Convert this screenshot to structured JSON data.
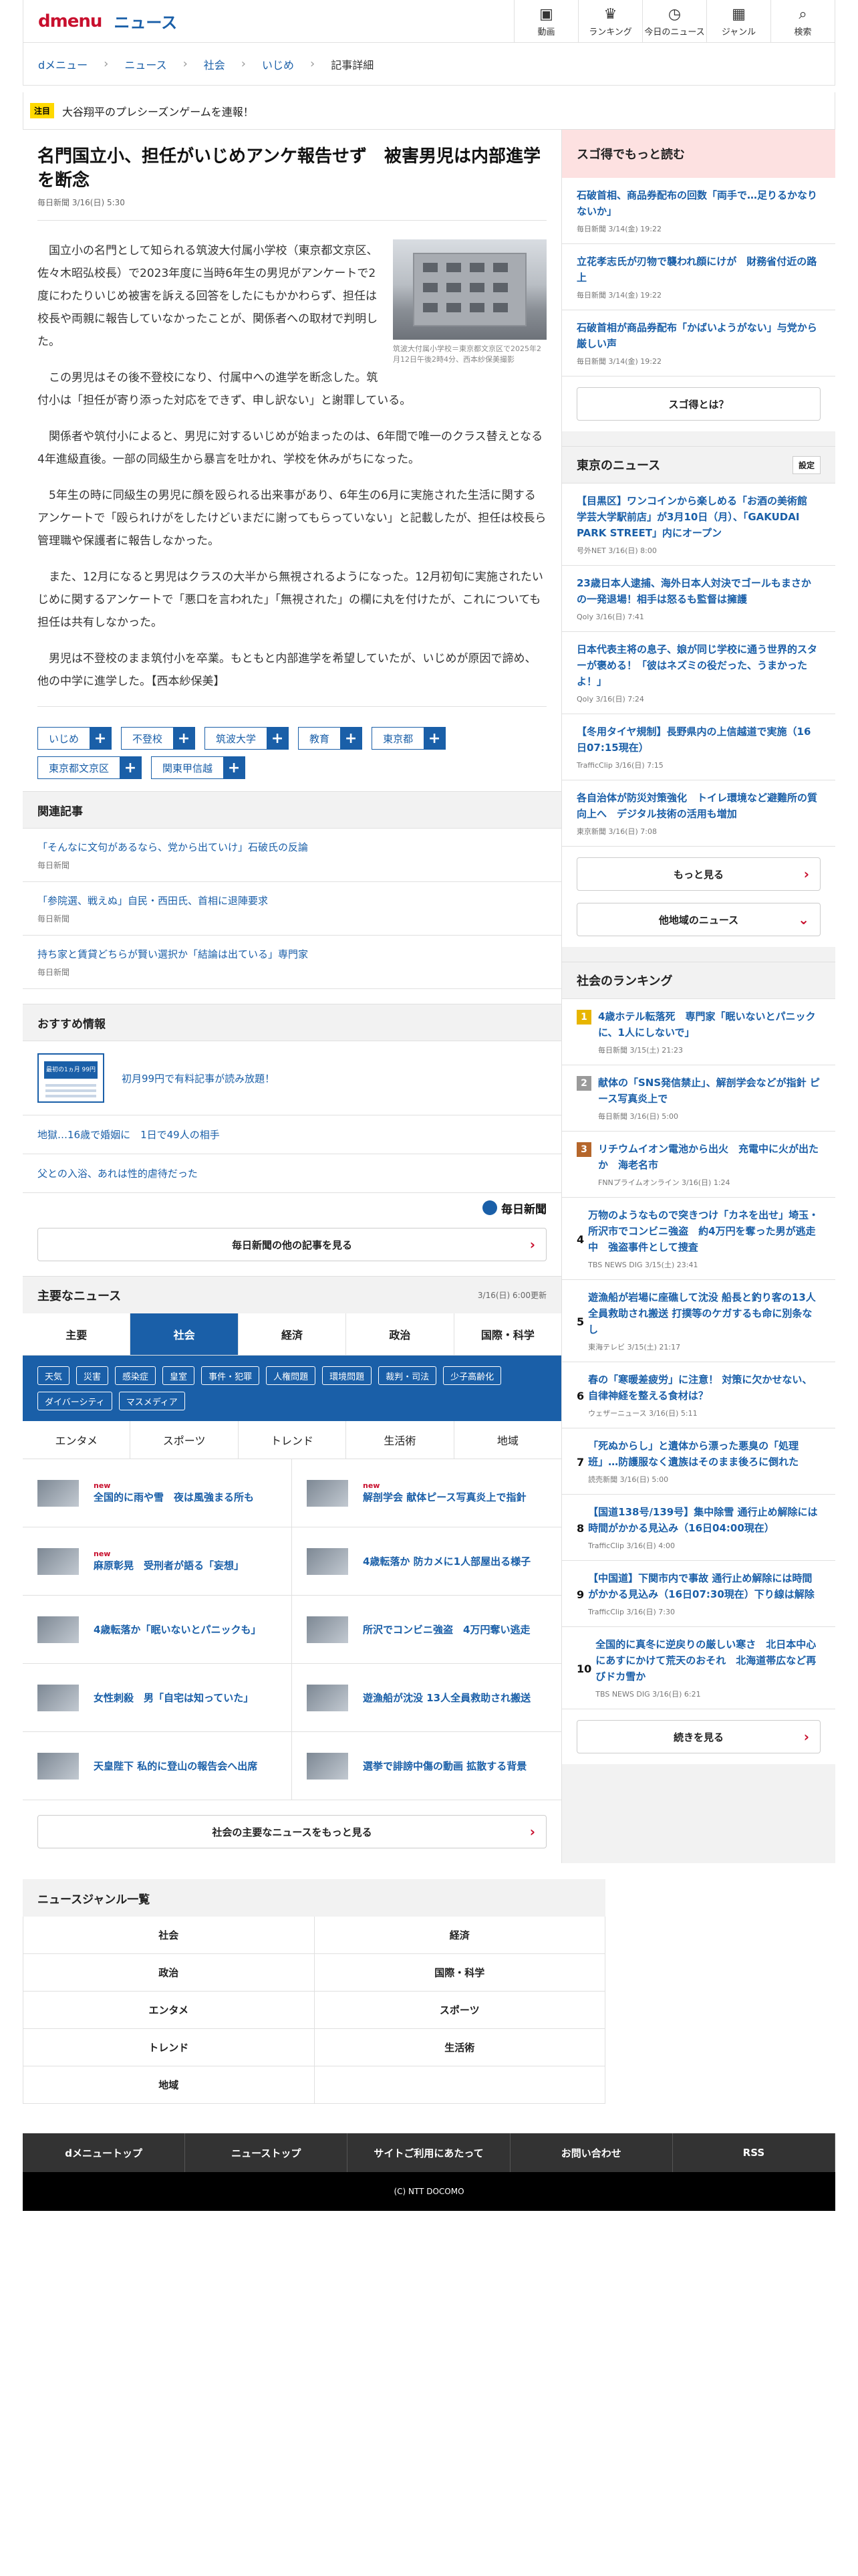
{
  "header": {
    "logo": "dmenu",
    "section": "ニュース",
    "nav": [
      {
        "label": "動画",
        "icon": "video-icon",
        "glyph": "▣"
      },
      {
        "label": "ランキング",
        "icon": "crown-icon",
        "glyph": "♛"
      },
      {
        "label": "今日のニュース",
        "icon": "clock-icon",
        "glyph": "◷"
      },
      {
        "label": "ジャンル",
        "icon": "grid-icon",
        "glyph": "▦"
      },
      {
        "label": "検索",
        "icon": "search-icon",
        "glyph": "⌕"
      }
    ]
  },
  "breadcrumb": [
    "dメニュー",
    "ニュース",
    "社会",
    "いじめ",
    "記事詳細"
  ],
  "notice": {
    "tag": "注目",
    "text": "大谷翔平のプレシーズンゲームを連報！"
  },
  "article": {
    "title": "名門国立小、担任がいじめアンケ報告せず　被害男児は内部進学を断念",
    "meta": "毎日新聞 3/16(日) 5:30",
    "photo_caption": "筑波大付属小学校＝東京都文京区で2025年2月12日午後2時4分、西本紗保美撮影",
    "paragraphs": [
      "国立小の名門として知られる筑波大付属小学校（東京都文京区、佐々木昭弘校長）で2023年度に当時6年生の男児がアンケートで2度にわたりいじめ被害を訴える回答をしたにもかかわらず、担任は校長や両親に報告していなかったことが、関係者への取材で判明した。",
      "この男児はその後不登校になり、付属中への進学を断念した。筑付小は「担任が寄り添った対応をできず、申し訳ない」と謝罪している。",
      "関係者や筑付小によると、男児に対するいじめが始まったのは、6年間で唯一のクラス替えとなる4年進級直後。一部の同級生から暴言を吐かれ、学校を休みがちになった。",
      "5年生の時に同級生の男児に顔を殴られる出来事があり、6年生の6月に実施された生活に関するアンケートで「殴られけがをしたけどいまだに謝ってもらっていない」と記載したが、担任は校長ら管理職や保護者に報告しなかった。",
      "また、12月になると男児はクラスの大半から無視されるようになった。12月初旬に実施されたいじめに関するアンケートで「悪口を言われた」「無視された」の欄に丸を付けたが、これについても担任は共有しなかった。",
      "男児は不登校のまま筑付小を卒業。もともと内部進学を希望していたが、いじめが原因で諦め、他の中学に進学した。【西本紗保美】"
    ],
    "tags": [
      "いじめ",
      "不登校",
      "筑波大学",
      "教育",
      "東京都",
      "東京都文京区",
      "関東甲信越"
    ]
  },
  "related": {
    "heading": "関連記事",
    "items": [
      {
        "title": "「そんなに文句があるなら、党から出ていけ」石破氏の反論",
        "source": "毎日新聞"
      },
      {
        "title": "「参院選、戦えぬ」自民・西田氏、首相に退陣要求",
        "source": "毎日新聞"
      },
      {
        "title": "持ち家と賃貸どちらが賢い選択か「結論は出ている」専門家",
        "source": "毎日新聞"
      }
    ]
  },
  "recommend": {
    "heading": "おすすめ情報",
    "items": [
      "初月99円で有料記事が読み放題！",
      "地獄…16歳で婚姻に　1日で49人の相手",
      "父との入浴、あれは性的虐待だった"
    ],
    "thumb_text": "最初の1ヵ月 99円",
    "brand": "毎日新聞",
    "more": "毎日新聞の他の記事を見る"
  },
  "main_news": {
    "heading": "主要なニュース",
    "updated": "3/16(日) 6:00更新",
    "tabs": [
      "主要",
      "社会",
      "経済",
      "政治",
      "国際・科学"
    ],
    "active_tab": 1,
    "subtags": [
      "天気",
      "災害",
      "感染症",
      "皇室",
      "事件・犯罪",
      "人権問題",
      "環境問題",
      "裁判・司法",
      "少子高齢化",
      "ダイバーシティ",
      "マスメディア"
    ],
    "tabs2": [
      "エンタメ",
      "スポーツ",
      "トレンド",
      "生活術",
      "地域"
    ],
    "items": [
      {
        "title": "全国的に雨や雪　夜は風強まる所も",
        "new": "new"
      },
      {
        "title": "解剖学会 献体ピース写真炎上で指針",
        "new": "new"
      },
      {
        "title": "麻原彰晃　受刑者が語る「妄想」",
        "new": "new"
      },
      {
        "title": "4歳転落か 防カメに1人部屋出る様子",
        "new": ""
      },
      {
        "title": "4歳転落か「眠いないとパニックも」",
        "new": ""
      },
      {
        "title": "所沢でコンビニ強盗　4万円奪い逃走",
        "new": ""
      },
      {
        "title": "女性刺殺　男「自宅は知っていた」",
        "new": ""
      },
      {
        "title": "遊漁船が沈没 13人全員救助され搬送",
        "new": ""
      },
      {
        "title": "天皇陛下 私的に登山の報告会へ出席",
        "new": ""
      },
      {
        "title": "選挙で誹謗中傷の動画 拡散する背景",
        "new": ""
      }
    ],
    "more": "社会の主要なニュースをもっと見る"
  },
  "sugotoku": {
    "heading": "スゴ得でもっと読む",
    "items": [
      {
        "title": "石破首相、商品券配布の回数「両手で…足りるかなりないか」",
        "meta": "毎日新聞 3/14(金) 19:22"
      },
      {
        "title": "立花孝志氏が刃物で襲われ顔にけが　財務省付近の路上",
        "meta": "毎日新聞 3/14(金) 19:22"
      },
      {
        "title": "石破首相が商品券配布「かばいようがない」与党から厳しい声",
        "meta": "毎日新聞 3/14(金) 19:22"
      }
    ],
    "button": "スゴ得とは？"
  },
  "tokyo": {
    "heading": "東京のニュース",
    "settings": "設定",
    "items": [
      {
        "title": "【目黒区】ワンコインから楽しめる「お酒の美術館 学芸大学駅前店」が3月10日（月）、「GAKUDAI PARK STREET」内にオープン",
        "meta": "号外NET 3/16(日) 8:00"
      },
      {
        "title": "23歳日本人逮捕、海外日本人対決でゴールもまさかの一発退場！相手は怒るも監督は擁護",
        "meta": "Qoly 3/16(日) 7:41"
      },
      {
        "title": "日本代表主将の息子、娘が同じ学校に通う世界的スターが褒める！「彼はネズミの役だった、うまかったよ！」",
        "meta": "Qoly 3/16(日) 7:24"
      },
      {
        "title": "【冬用タイヤ規制】長野県内の上信越道で実施（16日07:15現在）",
        "meta": "TrafficClip 3/16(日) 7:15"
      },
      {
        "title": "各自治体が防災対策強化　トイレ環境など避難所の質向上へ　デジタル技術の活用も増加",
        "meta": "東京新聞 3/16(日) 7:08"
      }
    ],
    "more": "もっと見る",
    "other": "他地域のニュース"
  },
  "ranking": {
    "heading": "社会のランキング",
    "items": [
      {
        "title": "4歳ホテル転落死　専門家「眠いないとパニックに、1人にしないで」",
        "meta": "毎日新聞 3/15(土) 21:23"
      },
      {
        "title": "献体の「SNS発信禁止」、解剖学会などが指針 ピース写真炎上で",
        "meta": "毎日新聞 3/16(日) 5:00"
      },
      {
        "title": "リチウムイオン電池から出火　充電中に火が出たか　海老名市",
        "meta": "FNNプライムオンライン 3/16(日) 1:24"
      },
      {
        "title": "万物のようなもので突きつけ「カネを出せ」埼玉・所沢市でコンビニ強盗　約4万円を奪った男が逃走中　強盗事件として捜査",
        "meta": "TBS NEWS DIG 3/15(土) 23:41"
      },
      {
        "title": "遊漁船が岩場に座礁して沈没 船長と釣り客の13人全員救助され搬送 打撲等のケガするも命に別条なし",
        "meta": "東海テレビ 3/15(土) 21:17"
      },
      {
        "title": "春の「寒暖差疲労」に注意！ 対策に欠かせない、自律神経を整える食材は？",
        "meta": "ウェザーニュース 3/16(日) 5:11"
      },
      {
        "title": "「死ぬからし」と遺体から漂った悪臭の「処理班」…防護服なく遺族はそのまま後ろに倒れた",
        "meta": "読売新聞 3/16(日) 5:00"
      },
      {
        "title": "【国道138号/139号】集中除雪 通行止め解除には時間がかかる見込み（16日04:00現在）",
        "meta": "TrafficClip 3/16(日) 4:00"
      },
      {
        "title": "【中国道】下関市内で事故 通行止め解除には時間がかかる見込み（16日07:30現在）下り線は解除",
        "meta": "TrafficClip 3/16(日) 7:30"
      },
      {
        "title": "全国的に真冬に逆戻りの厳しい寒さ　北日本中心にあすにかけて荒天のおそれ　北海道帯広など再びドカ雪か",
        "meta": "TBS NEWS DIG 3/16(日) 6:21"
      }
    ],
    "more": "続きを見る"
  },
  "genre": {
    "heading": "ニュースジャンル一覧",
    "items": [
      "社会",
      "経済",
      "政治",
      "国際・科学",
      "エンタメ",
      "スポーツ",
      "トレンド",
      "生活術",
      "地域",
      ""
    ]
  },
  "footer": {
    "links": [
      "dメニュートップ",
      "ニューストップ",
      "サイトご利用にあたって",
      "お問い合わせ",
      "RSS"
    ],
    "copyright": "(C) NTT DOCOMO"
  },
  "colors": {
    "brand_red": "#c8102e",
    "link_blue": "#1a5fa8",
    "notice_yellow": "#ffd900"
  }
}
